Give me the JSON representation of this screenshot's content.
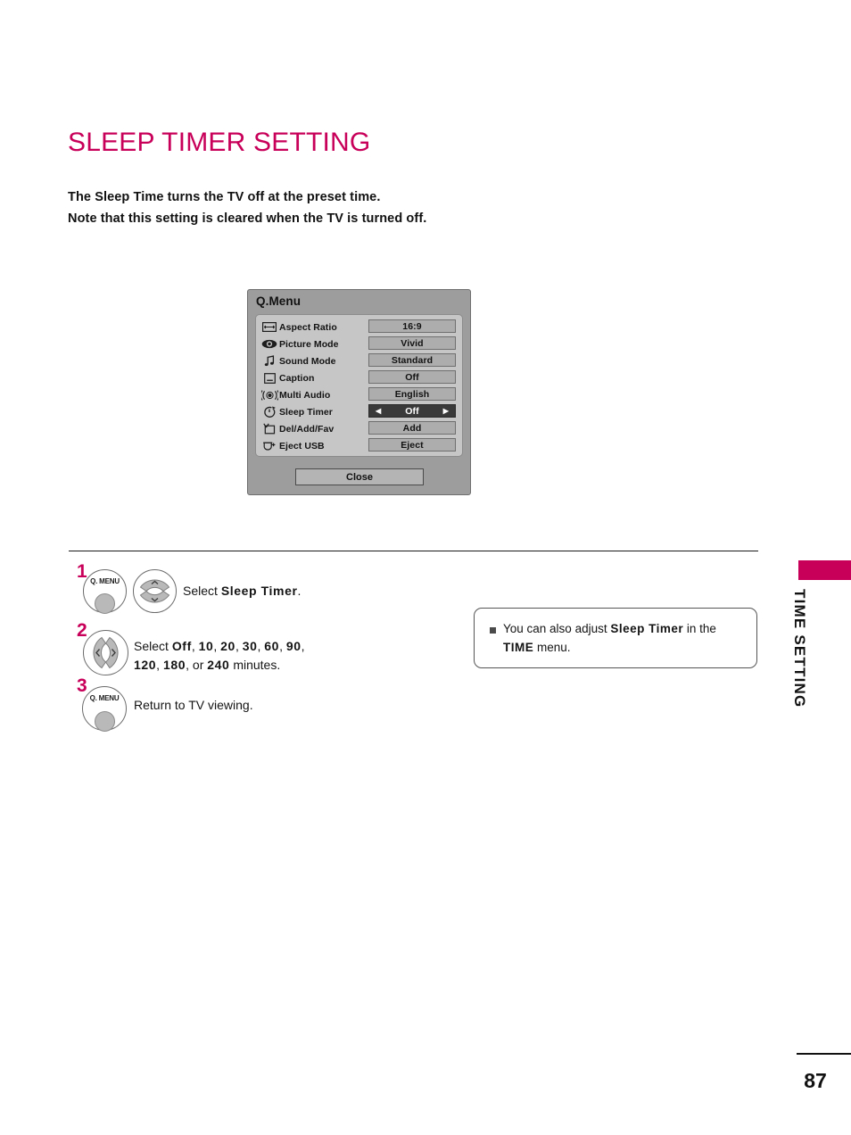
{
  "page": {
    "title": "SLEEP TIMER SETTING",
    "title_color": "#C8005A",
    "number": "87",
    "side_tab_label": "TIME SETTING"
  },
  "intro": {
    "line1": "The Sleep Time turns the TV off at the preset time.",
    "line2": "Note that this setting is cleared when the TV is turned off."
  },
  "osd": {
    "title": "Q.Menu",
    "close_label": "Close",
    "highlight_bg": "#3A3A3A",
    "rows": [
      {
        "icon": "aspect-ratio-icon",
        "label": "Aspect Ratio",
        "value": "16:9",
        "selected": false
      },
      {
        "icon": "picture-mode-icon",
        "label": "Picture Mode",
        "value": "Vivid",
        "selected": false
      },
      {
        "icon": "sound-mode-icon",
        "label": "Sound Mode",
        "value": "Standard",
        "selected": false
      },
      {
        "icon": "caption-icon",
        "label": "Caption",
        "value": "Off",
        "selected": false
      },
      {
        "icon": "multi-audio-icon",
        "label": "Multi Audio",
        "value": "English",
        "selected": false
      },
      {
        "icon": "sleep-timer-icon",
        "label": "Sleep Timer",
        "value": "Off",
        "selected": true
      },
      {
        "icon": "del-add-fav-icon",
        "label": "Del/Add/Fav",
        "value": "Add",
        "selected": false
      },
      {
        "icon": "eject-usb-icon",
        "label": "Eject USB",
        "value": "Eject",
        "selected": false
      }
    ],
    "arrow_left": "◀",
    "arrow_right": "▶"
  },
  "steps": [
    {
      "number": "1",
      "buttons": [
        "Q. MENU",
        "up-down-rocker"
      ],
      "button_label": "Q. MENU",
      "text_pre": "Select ",
      "text_bold": "Sleep Timer",
      "text_post": "."
    },
    {
      "number": "2",
      "buttons": [
        "left-right-rocker"
      ],
      "line1_pre": "Select ",
      "line1_values": [
        "Off",
        "10",
        "20",
        "30",
        "60",
        "90"
      ],
      "line2_values": [
        "120",
        "180"
      ],
      "line2_or": "or",
      "line2_last": "240",
      "line2_post": "minutes."
    },
    {
      "number": "3",
      "buttons": [
        "Q. MENU"
      ],
      "button_label": "Q. MENU",
      "text": "Return to TV viewing."
    }
  ],
  "note": {
    "bullet": "square-bullet",
    "pre": "You can also adjust ",
    "bold1": "Sleep Timer",
    "mid": " in the ",
    "bold2": "TIME",
    "post": " menu."
  }
}
